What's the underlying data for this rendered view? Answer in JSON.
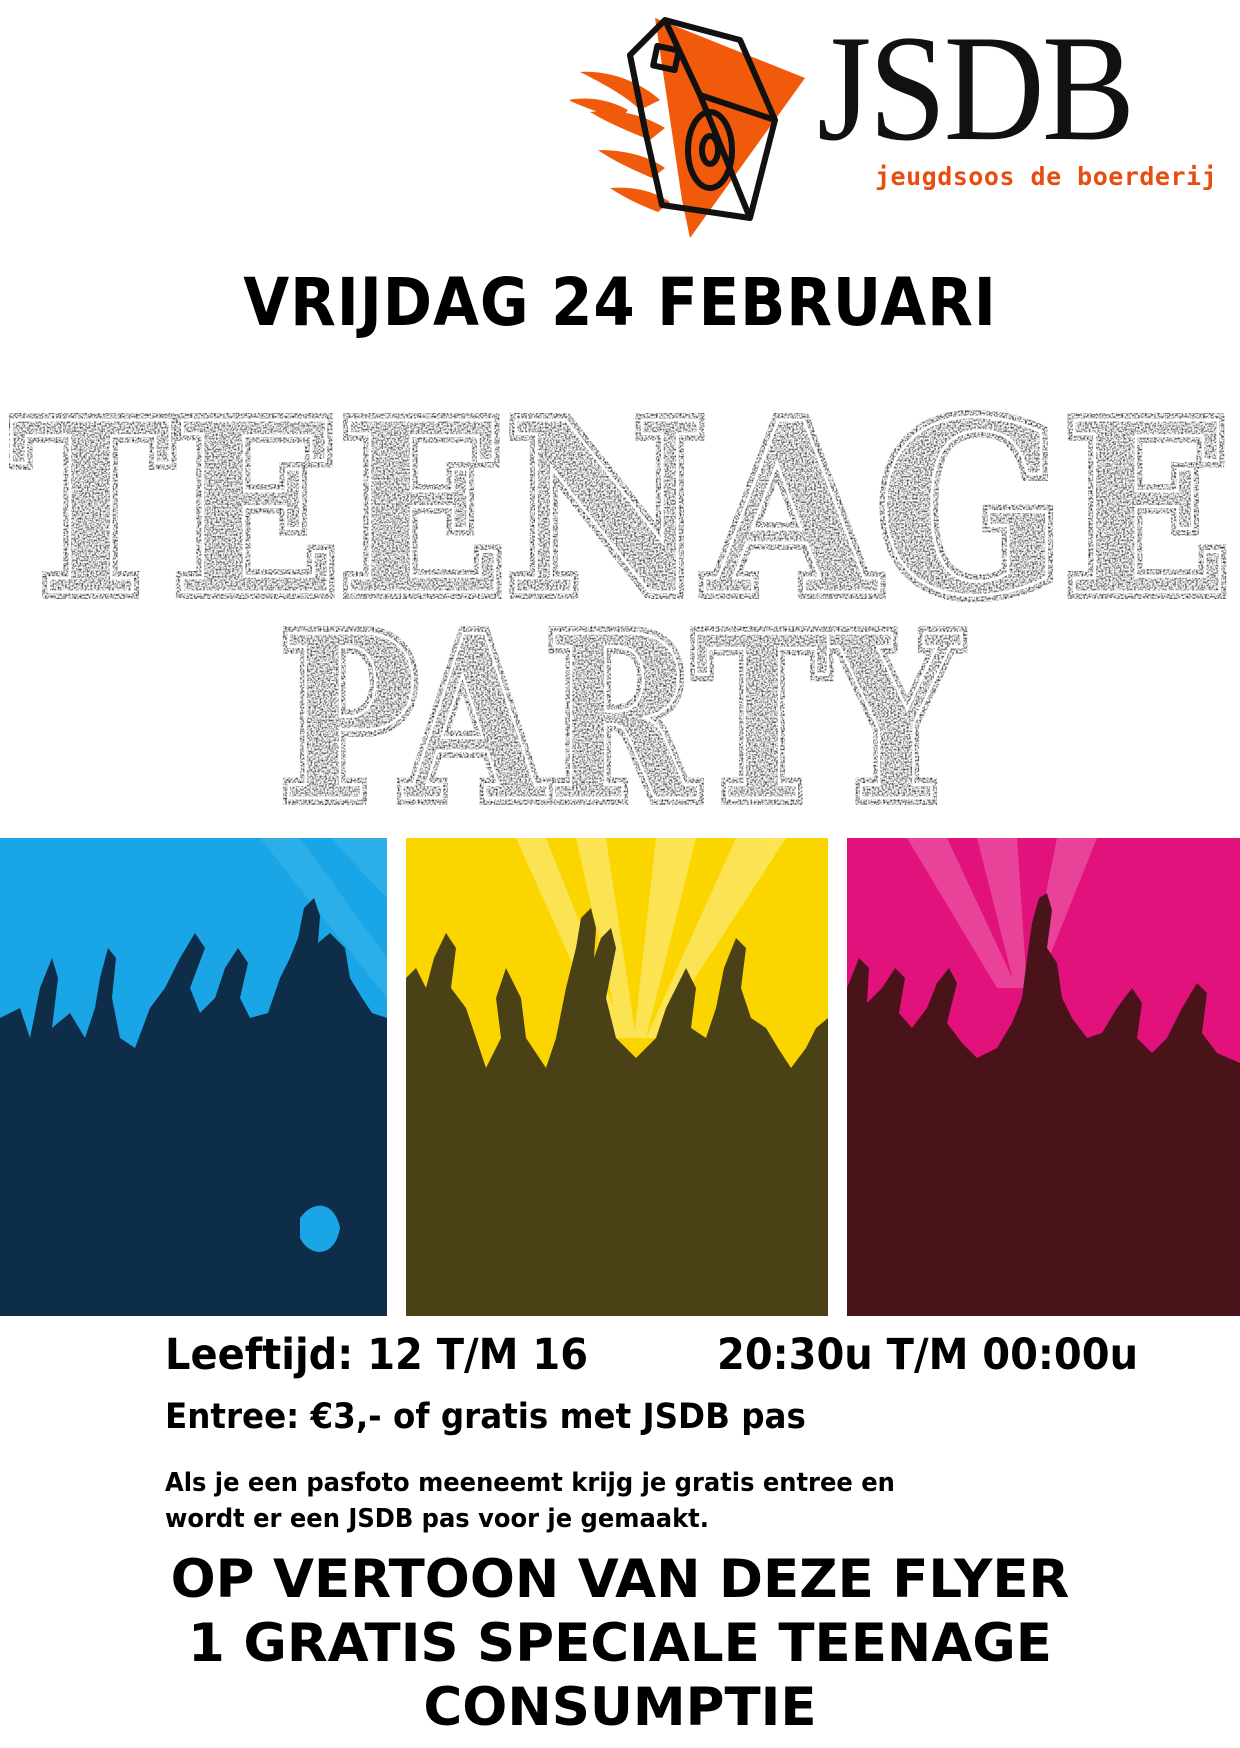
{
  "logo": {
    "wordmark": "JSDB",
    "tagline": "jeugdsoos de boerderij",
    "accent_color": "#f05a0a",
    "icon": "farmhouse-speaker-icon"
  },
  "date": "VRIJDAG 24 FEBRUARI",
  "title": {
    "line1": "TEENAGE",
    "line2": "PARTY"
  },
  "panels": [
    {
      "name": "blue-crowd",
      "background": "#1aa6e6",
      "silhouette": "#0d2d48"
    },
    {
      "name": "yellow-crowd",
      "background": "#fbd500",
      "silhouette": "#4a4117"
    },
    {
      "name": "pink-crowd",
      "background": "#e2127d",
      "silhouette": "#4a1319"
    }
  ],
  "info": {
    "age": "Leeftijd: 12 T/M 16",
    "time": "20:30u T/M 00:00u",
    "entry": "Entree: €3,- of gratis met JSDB pas",
    "note_line1": "Als je een pasfoto meeneemt krijg je gratis entree en",
    "note_line2": "wordt er een JSDB pas voor je gemaakt."
  },
  "promo": {
    "line1": "OP VERTOON VAN DEZE FLYER",
    "line2": "1 GRATIS SPECIALE TEENAGE",
    "line3": "CONSUMPTIE"
  }
}
